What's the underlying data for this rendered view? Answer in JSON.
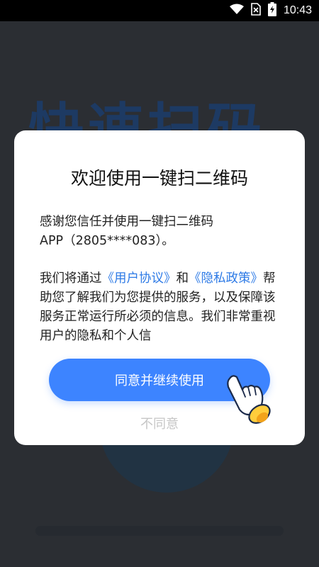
{
  "status_bar": {
    "time": "10:43",
    "icons": [
      "wifi-icon",
      "no-sim-icon",
      "battery-charging-icon"
    ]
  },
  "background": {
    "title": "快速扫码"
  },
  "dialog": {
    "title": "欢迎使用一键扫二维码",
    "intro_line1": "感谢您信任并使用一键扫二维码",
    "intro_line2": "APP（2805****083）。",
    "para2_prefix": "我们将通过",
    "user_agreement_link": "《用户协议》",
    "and": "和",
    "privacy_policy_link": "《隐私政策》",
    "para2_suffix": "帮助您了解我们为您提供的服务，以及保障该服务正常运行所必须的信息。我们非常重视用户的隐私和个人信",
    "agree_button": "同意并继续使用",
    "decline_link": "不同意",
    "hand_icon": "pointing-hand-icon"
  },
  "colors": {
    "primary": "#3d84ff",
    "link": "#2d7ae6",
    "disabled_text": "#c6c6c6"
  }
}
